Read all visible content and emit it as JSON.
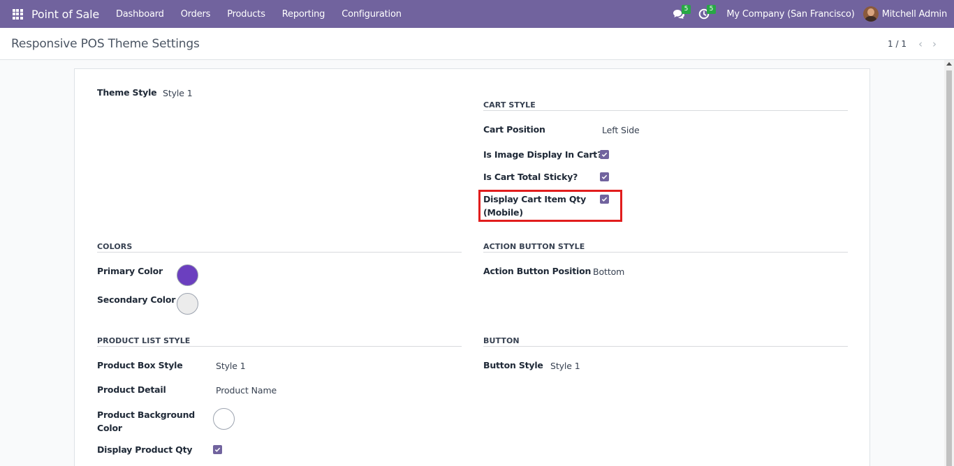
{
  "navbar": {
    "brand": "Point of Sale",
    "menu": [
      "Dashboard",
      "Orders",
      "Products",
      "Reporting",
      "Configuration"
    ],
    "messages_badge": "5",
    "activities_badge": "5",
    "company": "My Company (San Francisco)",
    "user": "Mitchell Admin"
  },
  "control_panel": {
    "title": "Responsive POS Theme Settings",
    "pager": "1 / 1"
  },
  "form": {
    "theme_style": {
      "label": "Theme Style",
      "value": "Style 1"
    },
    "cart_style": {
      "title": "CART STYLE",
      "cart_position": {
        "label": "Cart Position",
        "value": "Left Side"
      },
      "image_in_cart": {
        "label": "Is Image Display In Cart?",
        "checked": true
      },
      "cart_total_sticky": {
        "label": "Is Cart Total Sticky?",
        "checked": true
      },
      "display_cart_item_qty": {
        "label_line1": "Display Cart Item Qty",
        "label_line2": "(Mobile)",
        "checked": true
      }
    },
    "colors": {
      "title": "COLORS",
      "primary": {
        "label": "Primary Color",
        "color": "#6b3fbf"
      },
      "secondary": {
        "label": "Secondary Color",
        "color": "#ececec"
      }
    },
    "action_button_style": {
      "title": "ACTION BUTTON STYLE",
      "position": {
        "label": "Action Button Position",
        "value": "Bottom"
      }
    },
    "product_list_style": {
      "title": "PRODUCT LIST STYLE",
      "box_style": {
        "label": "Product Box Style",
        "value": "Style 1"
      },
      "detail": {
        "label": "Product Detail",
        "value": "Product Name"
      },
      "background_color": {
        "label_line1": "Product Background",
        "label_line2": "Color",
        "color": "#ffffff"
      },
      "display_qty": {
        "label": "Display Product Qty",
        "checked": true
      }
    },
    "button": {
      "title": "BUTTON",
      "style": {
        "label": "Button Style",
        "value": "Style 1"
      }
    }
  },
  "colors": {
    "navbar": "#71639e",
    "highlight": "#e11d1d"
  }
}
